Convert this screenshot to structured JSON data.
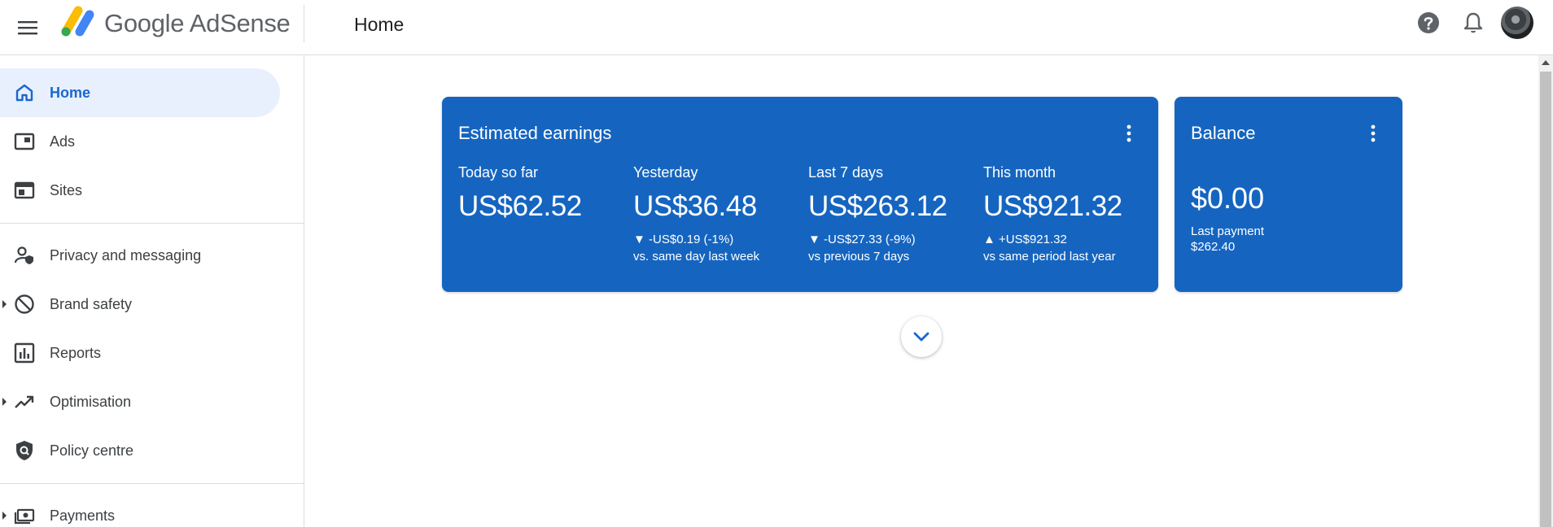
{
  "header": {
    "brand": "Google AdSense",
    "page_title": "Home",
    "icons": [
      "menu-icon",
      "adsense-logo-icon",
      "help-icon",
      "notifications-icon",
      "avatar"
    ]
  },
  "sidebar": {
    "items": [
      {
        "label": "Home",
        "icon": "home-icon",
        "active": true
      },
      {
        "label": "Ads",
        "icon": "ads-icon"
      },
      {
        "label": "Sites",
        "icon": "sites-icon"
      },
      {
        "label": "Privacy and messaging",
        "icon": "privacy-icon"
      },
      {
        "label": "Brand safety",
        "icon": "block-icon",
        "expandable": true
      },
      {
        "label": "Reports",
        "icon": "reports-icon"
      },
      {
        "label": "Optimisation",
        "icon": "trending-up-icon",
        "expandable": true
      },
      {
        "label": "Policy centre",
        "icon": "policy-shield-icon"
      },
      {
        "label": "Payments",
        "icon": "payments-icon",
        "expandable": true
      }
    ]
  },
  "earnings": {
    "title": "Estimated earnings",
    "metrics": [
      {
        "label": "Today so far",
        "value": "US$62.52",
        "change": "",
        "compare": ""
      },
      {
        "label": "Yesterday",
        "value": "US$36.48",
        "change": "▼ -US$0.19 (-1%)",
        "compare": "vs. same day last week"
      },
      {
        "label": "Last 7 days",
        "value": "US$263.12",
        "change": "▼ -US$27.33 (-9%)",
        "compare": "vs previous 7 days"
      },
      {
        "label": "This month",
        "value": "US$921.32",
        "change": "▲ +US$921.32",
        "compare": "vs same period last year"
      }
    ]
  },
  "balance": {
    "title": "Balance",
    "value": "$0.00",
    "last_payment_label": "Last payment",
    "last_payment_amount": "$262.40"
  },
  "colors": {
    "accent_blue": "#1565c0",
    "active_nav_bg": "#e8f0fe",
    "active_nav_text": "#1967d2"
  }
}
